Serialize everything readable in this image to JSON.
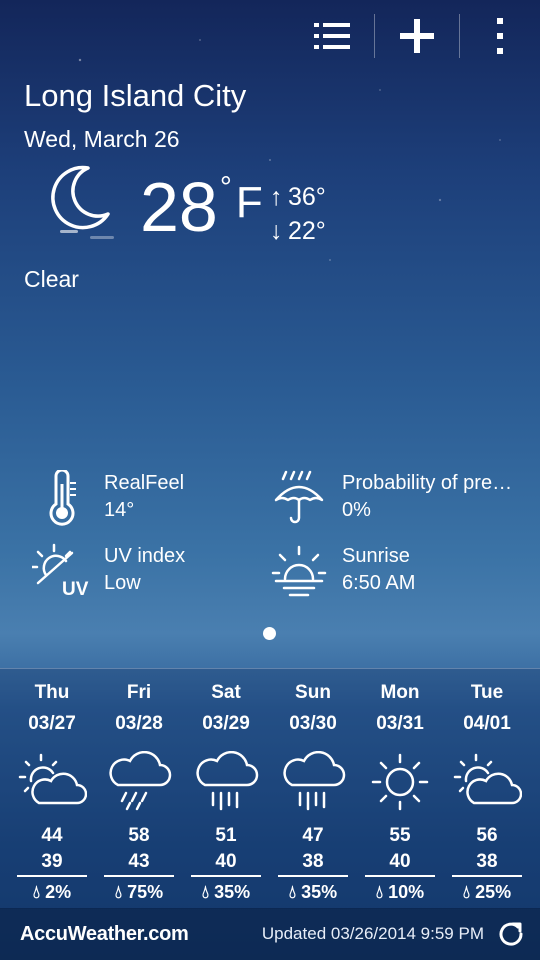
{
  "toolbar": {
    "icons": [
      "list-icon",
      "add-icon",
      "more-vert-icon"
    ]
  },
  "location": {
    "city": "Long Island City",
    "date": "Wed, March 26"
  },
  "current": {
    "icon": "moon-icon",
    "temperature": "28",
    "degree_symbol": "°",
    "unit": "F",
    "high": "36°",
    "low": "22°",
    "condition": "Clear"
  },
  "details": [
    {
      "icon": "thermometer-icon",
      "label": "RealFeel",
      "value": "14°"
    },
    {
      "icon": "umbrella-rain-icon",
      "label": "Probability of pre…",
      "value": "0%"
    },
    {
      "icon": "uv-index-icon",
      "label": "UV index",
      "value": "Low"
    },
    {
      "icon": "sunrise-icon",
      "label": "Sunrise",
      "value": "6:50 AM"
    }
  ],
  "forecast": [
    {
      "day": "Thu",
      "date": "03/27",
      "icon": "partly-cloudy-icon",
      "high": "44",
      "low": "39",
      "pop": "2%"
    },
    {
      "day": "Fri",
      "date": "03/28",
      "icon": "sleet-icon",
      "high": "58",
      "low": "43",
      "pop": "75%"
    },
    {
      "day": "Sat",
      "date": "03/29",
      "icon": "rain-icon",
      "high": "51",
      "low": "40",
      "pop": "35%"
    },
    {
      "day": "Sun",
      "date": "03/30",
      "icon": "rain-icon",
      "high": "47",
      "low": "38",
      "pop": "35%"
    },
    {
      "day": "Mon",
      "date": "03/31",
      "icon": "sunny-icon",
      "high": "55",
      "low": "40",
      "pop": "10%"
    },
    {
      "day": "Tue",
      "date": "04/01",
      "icon": "partly-cloudy-icon",
      "high": "56",
      "low": "38",
      "pop": "25%"
    }
  ],
  "footer": {
    "brand": "AccuWeather.com",
    "updated": "Updated 03/26/2014 9:59 PM"
  }
}
